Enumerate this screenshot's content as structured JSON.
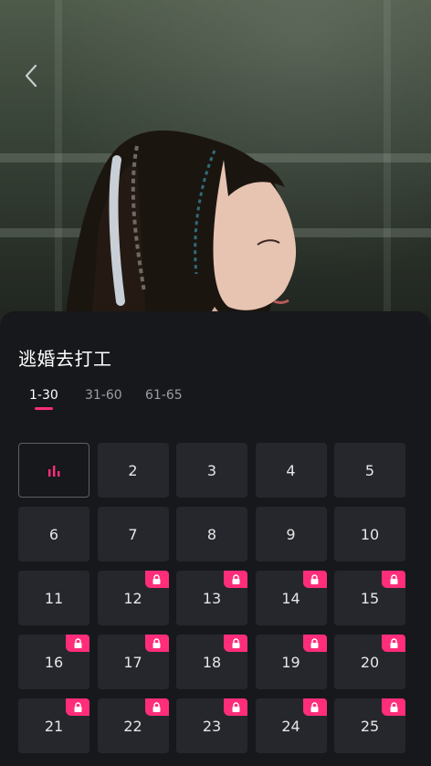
{
  "drama": {
    "title": "逃婚去打工"
  },
  "ranges": [
    {
      "label": "1-30",
      "active": true
    },
    {
      "label": "31-60",
      "active": false
    },
    {
      "label": "61-65",
      "active": false
    }
  ],
  "episodes": [
    {
      "label": "",
      "playing": true,
      "locked": false
    },
    {
      "label": "2",
      "playing": false,
      "locked": false
    },
    {
      "label": "3",
      "playing": false,
      "locked": false
    },
    {
      "label": "4",
      "playing": false,
      "locked": false
    },
    {
      "label": "5",
      "playing": false,
      "locked": false
    },
    {
      "label": "6",
      "playing": false,
      "locked": false
    },
    {
      "label": "7",
      "playing": false,
      "locked": false
    },
    {
      "label": "8",
      "playing": false,
      "locked": false
    },
    {
      "label": "9",
      "playing": false,
      "locked": false
    },
    {
      "label": "10",
      "playing": false,
      "locked": false
    },
    {
      "label": "11",
      "playing": false,
      "locked": false
    },
    {
      "label": "12",
      "playing": false,
      "locked": true
    },
    {
      "label": "13",
      "playing": false,
      "locked": true
    },
    {
      "label": "14",
      "playing": false,
      "locked": true
    },
    {
      "label": "15",
      "playing": false,
      "locked": true
    },
    {
      "label": "16",
      "playing": false,
      "locked": true
    },
    {
      "label": "17",
      "playing": false,
      "locked": true
    },
    {
      "label": "18",
      "playing": false,
      "locked": true
    },
    {
      "label": "19",
      "playing": false,
      "locked": true
    },
    {
      "label": "20",
      "playing": false,
      "locked": true
    },
    {
      "label": "21",
      "playing": false,
      "locked": true
    },
    {
      "label": "22",
      "playing": false,
      "locked": true
    },
    {
      "label": "23",
      "playing": false,
      "locked": true
    },
    {
      "label": "24",
      "playing": false,
      "locked": true
    },
    {
      "label": "25",
      "playing": false,
      "locked": true
    }
  ],
  "icons": {
    "back": "chevron-left-icon",
    "playing": "playing-bars-icon",
    "lock": "lock-icon"
  },
  "colors": {
    "accent": "#ff2d7a",
    "sheet_background": "#17181c",
    "tile_background": "#26272c",
    "text_primary": "#ffffff",
    "text_secondary": "#9c9ea5"
  }
}
